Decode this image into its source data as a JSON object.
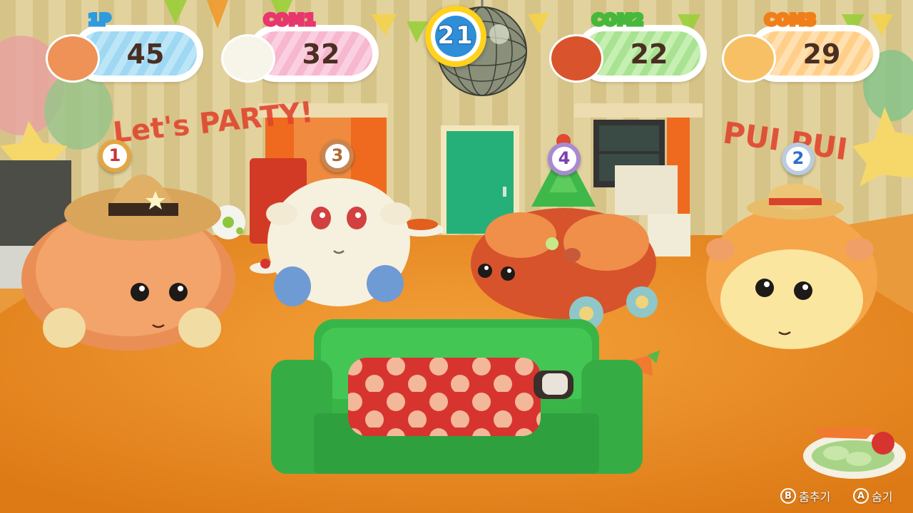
{
  "players": [
    {
      "tag": "1P",
      "score": "45",
      "color": "#2e9be0",
      "pill_color": "#9fd8f2"
    },
    {
      "tag": "COM1",
      "score": "32",
      "color": "#e8366e",
      "pill_color": "#f6b7cf"
    },
    {
      "tag": "COM2",
      "score": "22",
      "color": "#46b83c",
      "pill_color": "#a9e292"
    },
    {
      "tag": "COM3",
      "score": "29",
      "color": "#f07f1a",
      "pill_color": "#ffcf8a"
    }
  ],
  "timer": {
    "value": "21"
  },
  "ranks": [
    {
      "value": "1",
      "color": "#c7353a",
      "medal": "gold"
    },
    {
      "value": "3",
      "color": "#b06a34",
      "medal": "bronze"
    },
    {
      "value": "4",
      "color": "#7a3fb0",
      "medal": "purple"
    },
    {
      "value": "2",
      "color": "#2a71c8",
      "medal": "silver"
    }
  ],
  "wall_text": {
    "left": "Let's PARTY!",
    "right": "PUI PUI"
  },
  "controls": [
    {
      "button": "B",
      "label": "춤추기"
    },
    {
      "button": "A",
      "label": "숨기"
    }
  ],
  "icons": [
    "disco-ball-icon",
    "cowboy-hat-icon",
    "party-hat-icon",
    "straw-hat-icon",
    "carrot-icon",
    "soccer-ball-icon"
  ]
}
